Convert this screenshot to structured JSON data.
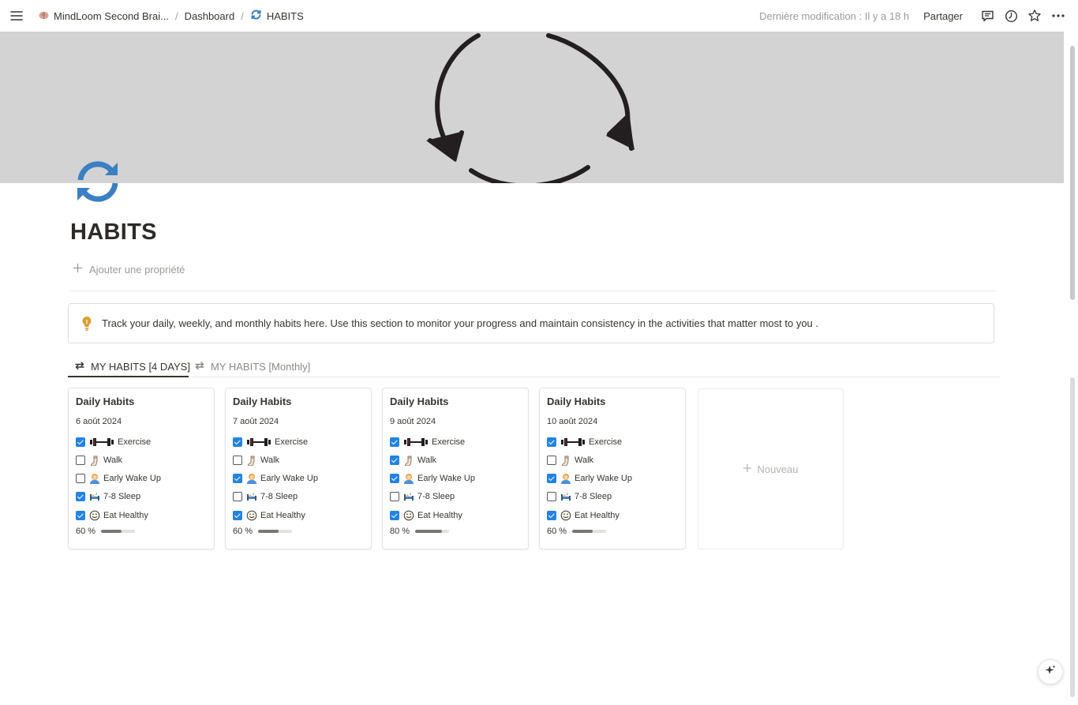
{
  "topbar": {
    "breadcrumbs": [
      {
        "label": "MindLoom Second Brai..."
      },
      {
        "label": "Dashboard"
      },
      {
        "label": "HABITS"
      }
    ],
    "last_modified": "Dernière modification : Il y a 18 h",
    "share_label": "Partager"
  },
  "page": {
    "title": "HABITS",
    "add_property": "Ajouter une propriété",
    "callout": "Track your daily, weekly, and monthly habits here. Use this section to monitor your progress and maintain consistency in the activities that matter most to you ."
  },
  "tabs": [
    {
      "label": "MY HABITS [4 DAYS]",
      "active": true
    },
    {
      "label": "MY HABITS [Monthly]",
      "active": false
    }
  ],
  "cards": [
    {
      "title": "Daily Habits",
      "date": "6 août 2024",
      "habits": [
        {
          "label": "Exercise",
          "checked": true
        },
        {
          "label": "Walk",
          "checked": false
        },
        {
          "label": "Early Wake Up",
          "checked": false
        },
        {
          "label": "7-8 Sleep",
          "checked": true
        },
        {
          "label": "Eat Healthy",
          "checked": true
        }
      ],
      "progress_label": "60 %",
      "progress": 0.6
    },
    {
      "title": "Daily Habits",
      "date": "7 août 2024",
      "habits": [
        {
          "label": "Exercise",
          "checked": true
        },
        {
          "label": "Walk",
          "checked": false
        },
        {
          "label": "Early Wake Up",
          "checked": true
        },
        {
          "label": "7-8 Sleep",
          "checked": false
        },
        {
          "label": "Eat Healthy",
          "checked": true
        }
      ],
      "progress_label": "60 %",
      "progress": 0.6
    },
    {
      "title": "Daily Habits",
      "date": "9 août 2024",
      "habits": [
        {
          "label": "Exercise",
          "checked": true
        },
        {
          "label": "Walk",
          "checked": true
        },
        {
          "label": "Early Wake Up",
          "checked": true
        },
        {
          "label": "7-8 Sleep",
          "checked": false
        },
        {
          "label": "Eat Healthy",
          "checked": true
        }
      ],
      "progress_label": "80 %",
      "progress": 0.8
    },
    {
      "title": "Daily Habits",
      "date": "10 août 2024",
      "habits": [
        {
          "label": "Exercise",
          "checked": true
        },
        {
          "label": "Walk",
          "checked": false
        },
        {
          "label": "Early Wake Up",
          "checked": true
        },
        {
          "label": "7-8 Sleep",
          "checked": false
        },
        {
          "label": "Eat Healthy",
          "checked": true
        }
      ],
      "progress_label": "60 %",
      "progress": 0.6
    }
  ],
  "new_card_label": "Nouveau",
  "habit_icons": [
    "dumbbell-icon",
    "sock-icon",
    "person-icon",
    "sleeping-bed-icon",
    "smiling-face-icon"
  ],
  "colors": {
    "accent": "#2383e2",
    "page_icon": "#3b7fc4",
    "cover_bg": "#d3d3d3",
    "callout_icon": "#d9a036",
    "progress_fill": "#787774"
  }
}
